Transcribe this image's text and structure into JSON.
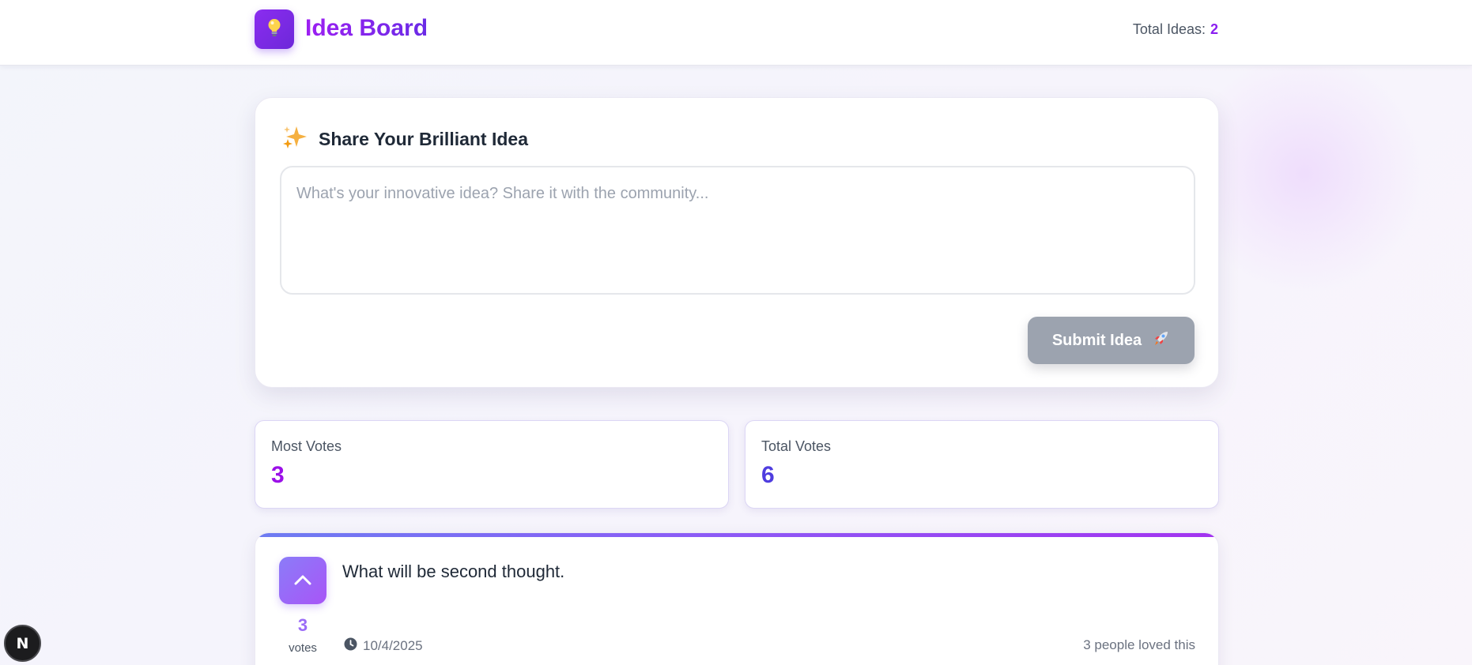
{
  "app": {
    "title": "Idea Board",
    "logo_icon": "lightbulb-icon",
    "total_ideas_label": "Total Ideas:",
    "total_ideas_count": "2"
  },
  "composer": {
    "title": "Share Your Brilliant Idea",
    "title_icon": "sparkles-icon",
    "placeholder": "What's your innovative idea? Share it with the community...",
    "value": "",
    "submit_label": "Submit Idea",
    "submit_icon": "rocket-icon",
    "submit_disabled": true
  },
  "stats": {
    "most_votes_label": "Most Votes",
    "most_votes_value": "3",
    "total_votes_label": "Total Votes",
    "total_votes_value": "6"
  },
  "ideas": [
    {
      "text": "What will be second thought.",
      "votes": "3",
      "votes_label": "votes",
      "date": "10/4/2025",
      "loved_text": "3 people loved this",
      "upvote_icon": "chevron-up-icon",
      "date_icon": "clock-icon"
    }
  ],
  "dev_badge": {
    "label": "N",
    "icon": "nextjs-logo-icon"
  },
  "colors": {
    "brand_purple": "#7c1ff0",
    "stat_most_votes": "#9b10e8",
    "stat_total_votes": "#4f3ddf",
    "submit_disabled_bg": "#9ca3af"
  }
}
